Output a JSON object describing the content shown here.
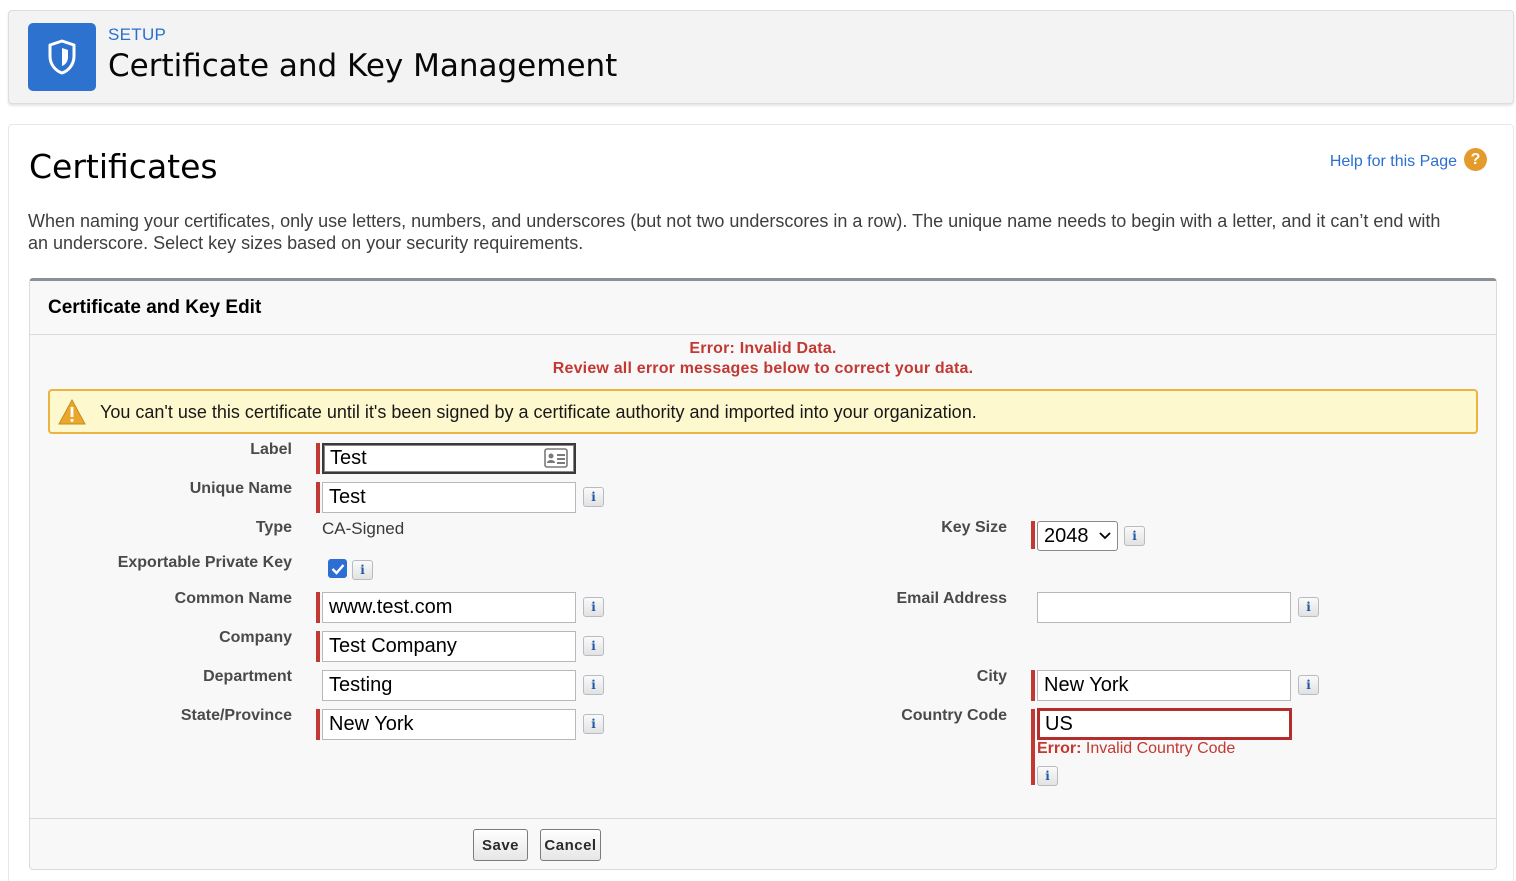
{
  "header": {
    "kicker": "SETUP",
    "title": "Certificate and Key Management",
    "icon": "shield-icon"
  },
  "page": {
    "title": "Certificates",
    "help_link": "Help for this Page",
    "help_icon": "?",
    "intro_line1": "When naming your certificates, only use letters, numbers, and underscores (but not two underscores in a row). The unique name needs to begin with a letter, and it can’t end with",
    "intro_line2": "an underscore. Select key sizes based on your security requirements."
  },
  "section": {
    "title": "Certificate and Key Edit",
    "error_line1": "Error: Invalid Data.",
    "error_line2": "Review all error messages below to correct your data.",
    "warning": "You can't use this certificate until it's been signed by a certificate authority and imported into your organization."
  },
  "form": {
    "label": {
      "label": "Label",
      "value": "Test"
    },
    "unique_name": {
      "label": "Unique Name",
      "value": "Test"
    },
    "type": {
      "label": "Type",
      "value": "CA-Signed"
    },
    "exportable": {
      "label": "Exportable Private Key",
      "checked": true
    },
    "common_name": {
      "label": "Common Name",
      "value": "www.test.com"
    },
    "company": {
      "label": "Company",
      "value": "Test Company"
    },
    "department": {
      "label": "Department",
      "value": "Testing"
    },
    "state": {
      "label": "State/Province",
      "value": "New York"
    },
    "key_size": {
      "label": "Key Size",
      "value": "2048"
    },
    "email": {
      "label": "Email Address",
      "value": ""
    },
    "city": {
      "label": "City",
      "value": "New York"
    },
    "country": {
      "label": "Country Code",
      "value": "US",
      "error_prefix": "Error:",
      "error_text": " Invalid Country Code"
    },
    "info_glyph": "i"
  },
  "buttons": {
    "save": "Save",
    "cancel": "Cancel"
  },
  "colors": {
    "brand_blue": "#2e72cf",
    "error_red": "#c23934",
    "warning_bg": "#fef8cf",
    "warning_border": "#e9b442"
  }
}
